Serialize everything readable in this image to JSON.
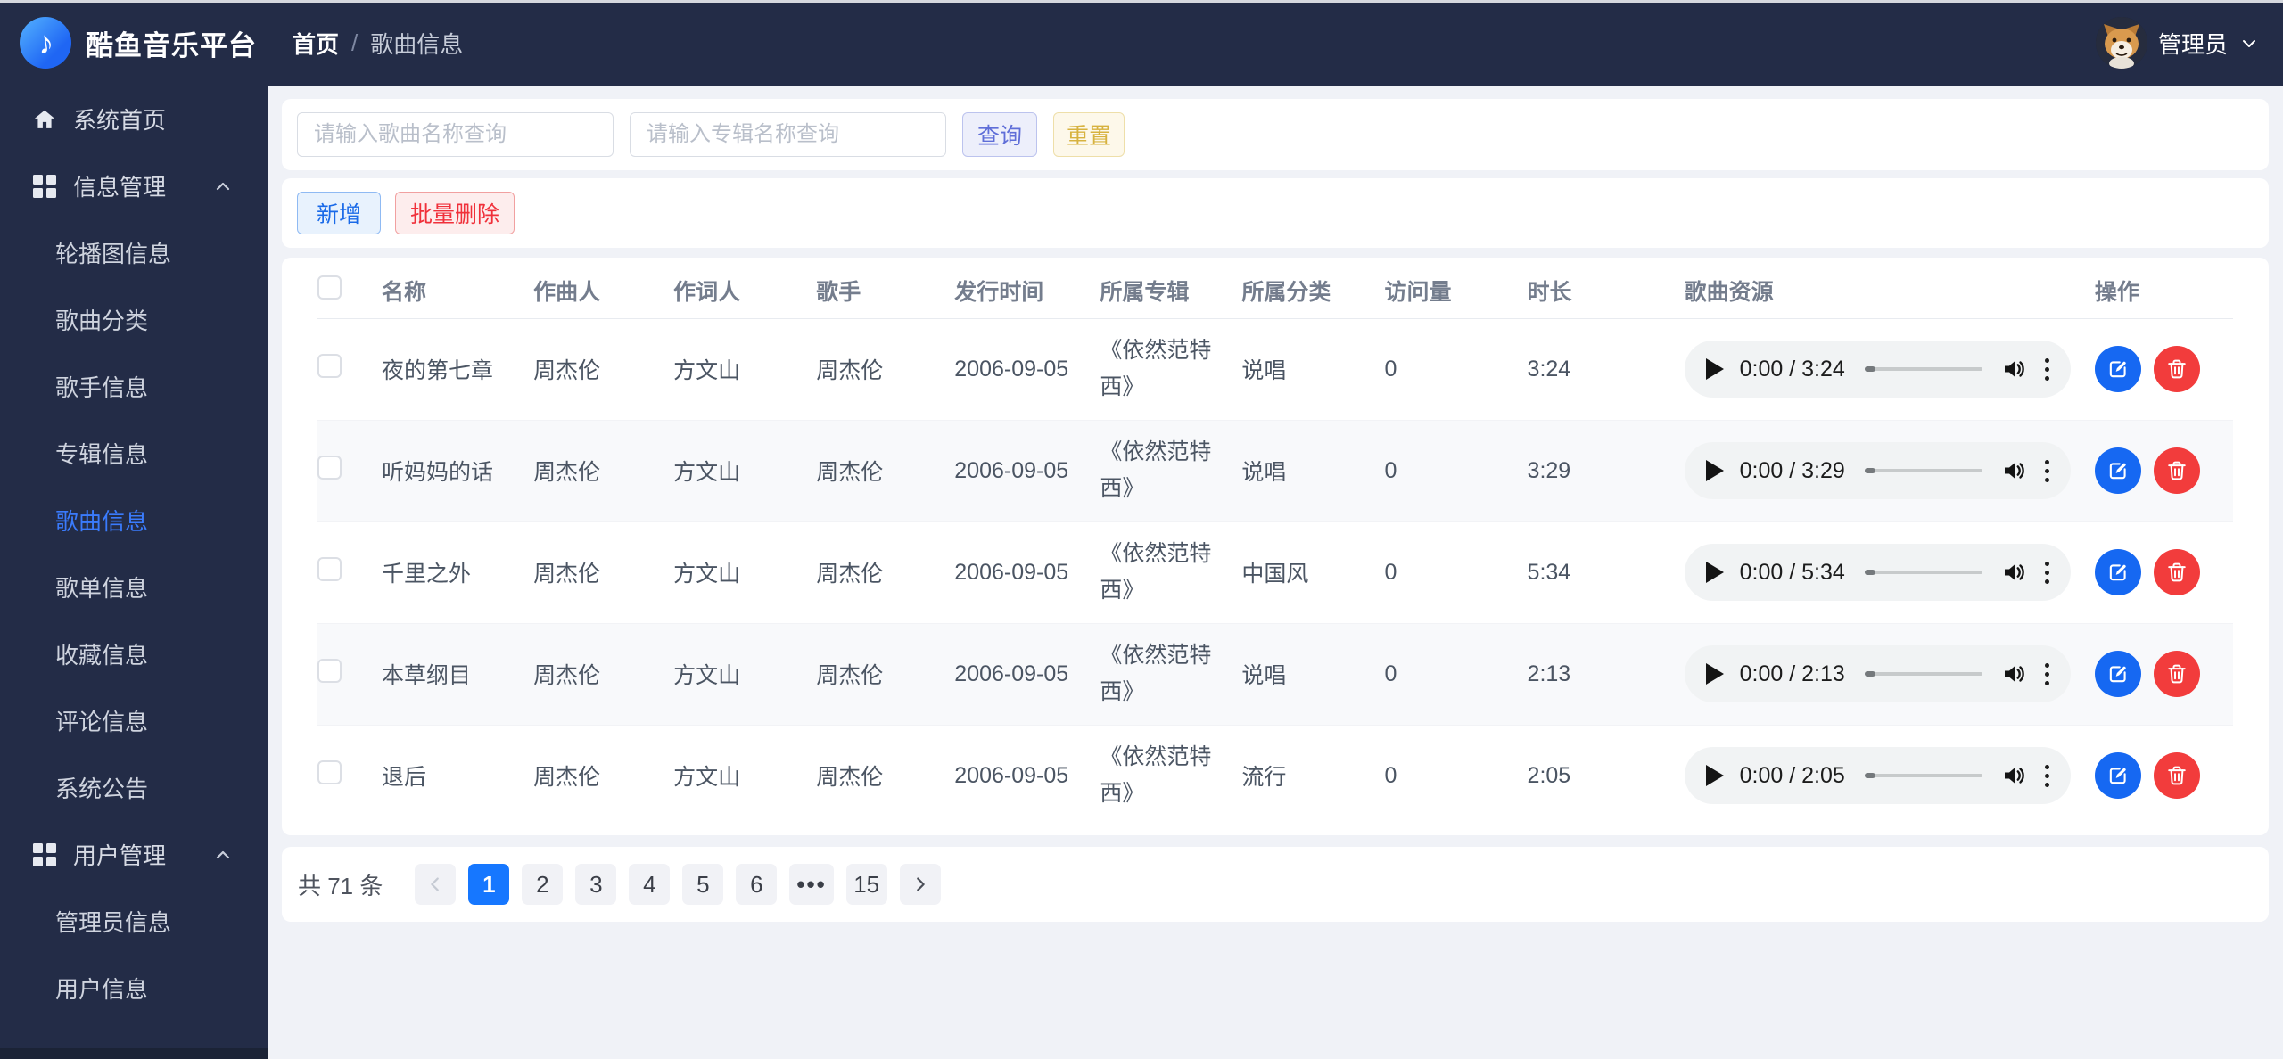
{
  "colors": {
    "header_bg": "#232c47",
    "active_menu_blue": "#3a7bfd",
    "pagination_active_blue": "#1677ff",
    "edit_button_blue": "#1668f2",
    "delete_button_red": "#f23c3c"
  },
  "app": {
    "title": "酷鱼音乐平台",
    "logo_icon": "music-note-icon"
  },
  "header": {
    "breadcrumb": {
      "home": "首页",
      "separator": "/",
      "current": "歌曲信息"
    },
    "user": {
      "name": "管理员",
      "avatar_icon": "shiba-dog-avatar"
    }
  },
  "sidebar": {
    "sections": [
      {
        "type": "item",
        "icon": "home-icon",
        "label": "系统首页"
      },
      {
        "type": "group",
        "icon": "grid-icon",
        "label": "信息管理",
        "expanded": true,
        "children": [
          {
            "label": "轮播图信息"
          },
          {
            "label": "歌曲分类"
          },
          {
            "label": "歌手信息"
          },
          {
            "label": "专辑信息"
          },
          {
            "label": "歌曲信息",
            "active": true
          },
          {
            "label": "歌单信息"
          },
          {
            "label": "收藏信息"
          },
          {
            "label": "评论信息"
          },
          {
            "label": "系统公告"
          }
        ]
      },
      {
        "type": "group",
        "icon": "grid-icon",
        "label": "用户管理",
        "expanded": true,
        "children": [
          {
            "label": "管理员信息"
          },
          {
            "label": "用户信息"
          }
        ]
      }
    ]
  },
  "search": {
    "song_placeholder": "请输入歌曲名称查询",
    "album_placeholder": "请输入专辑名称查询",
    "query_label": "查询",
    "reset_label": "重置"
  },
  "toolbar": {
    "add_label": "新增",
    "batch_delete_label": "批量删除"
  },
  "table": {
    "headers": [
      "名称",
      "作曲人",
      "作词人",
      "歌手",
      "发行时间",
      "所属专辑",
      "所属分类",
      "访问量",
      "时长",
      "歌曲资源",
      "操作"
    ],
    "rows": [
      {
        "name": "夜的第七章",
        "composer": "周杰伦",
        "lyricist": "方文山",
        "singer": "周杰伦",
        "release_date": "2006-09-05",
        "album": "《依然范特西》",
        "category": "说唱",
        "visits": "0",
        "duration": "3:24",
        "player_time": "0:00 / 3:24"
      },
      {
        "name": "听妈妈的话",
        "composer": "周杰伦",
        "lyricist": "方文山",
        "singer": "周杰伦",
        "release_date": "2006-09-05",
        "album": "《依然范特西》",
        "category": "说唱",
        "visits": "0",
        "duration": "3:29",
        "player_time": "0:00 / 3:29"
      },
      {
        "name": "千里之外",
        "composer": "周杰伦",
        "lyricist": "方文山",
        "singer": "周杰伦",
        "release_date": "2006-09-05",
        "album": "《依然范特西》",
        "category": "中国风",
        "visits": "0",
        "duration": "5:34",
        "player_time": "0:00 / 5:34"
      },
      {
        "name": "本草纲目",
        "composer": "周杰伦",
        "lyricist": "方文山",
        "singer": "周杰伦",
        "release_date": "2006-09-05",
        "album": "《依然范特西》",
        "category": "说唱",
        "visits": "0",
        "duration": "2:13",
        "player_time": "0:00 / 2:13"
      },
      {
        "name": "退后",
        "composer": "周杰伦",
        "lyricist": "方文山",
        "singer": "周杰伦",
        "release_date": "2006-09-05",
        "album": "《依然范特西》",
        "category": "流行",
        "visits": "0",
        "duration": "2:05",
        "player_time": "0:00 / 2:05"
      }
    ]
  },
  "pagination": {
    "total_label": "共 71 条",
    "prev_icon": "chevron-left-icon",
    "next_icon": "chevron-right-icon",
    "pages": [
      "1",
      "2",
      "3",
      "4",
      "5",
      "6",
      "•••",
      "15"
    ],
    "ellipsis": "•••",
    "active_page": "1"
  }
}
